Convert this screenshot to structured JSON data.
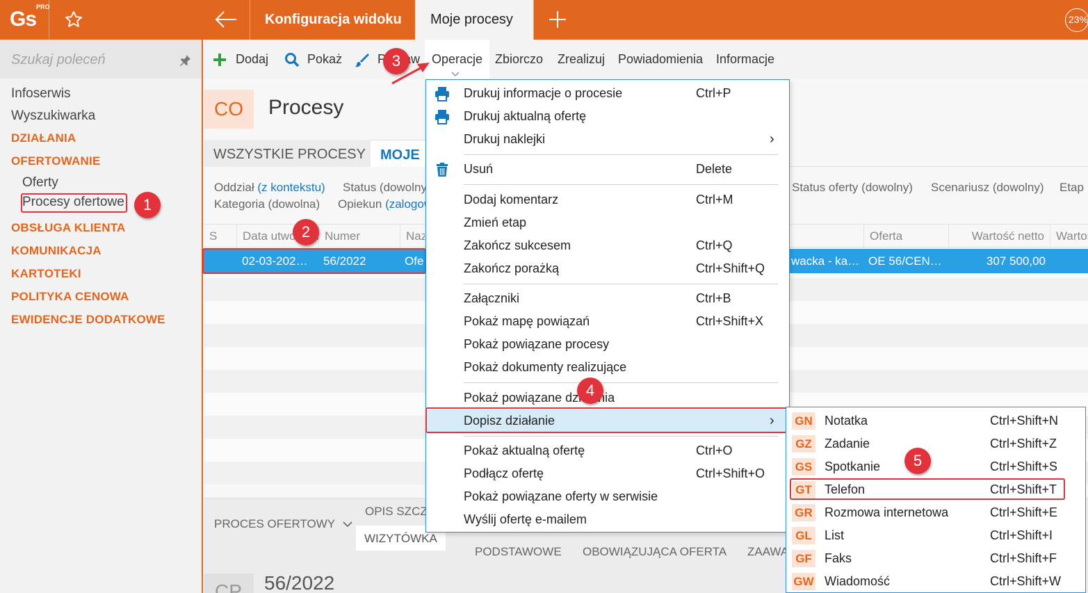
{
  "app": {
    "logo_text": "Gs",
    "logo_badge": "PRO",
    "zoom": "23%"
  },
  "tabs": [
    {
      "label": "Konfiguracja widoku"
    },
    {
      "label": "Moje procesy"
    }
  ],
  "sidebar": {
    "search_placeholder": "Szukaj poleceń",
    "items": [
      {
        "label": "Infoserwis"
      },
      {
        "label": "Wyszukiwarka"
      }
    ],
    "sections": [
      {
        "label": "DZIAŁANIA"
      },
      {
        "label": "OFERTOWANIE"
      },
      {
        "label": "OBSŁUGA KLIENTA"
      },
      {
        "label": "KOMUNIKACJA"
      },
      {
        "label": "KARTOTEKI"
      },
      {
        "label": "POLITYKA CENOWA"
      },
      {
        "label": "EWIDENCJE DODATKOWE"
      }
    ],
    "sub_items": [
      {
        "label": "Oferty"
      },
      {
        "label": "Procesy ofertowe"
      }
    ]
  },
  "toolbar": {
    "add": "Dodaj",
    "show": "Pokaż",
    "edit": "Popraw",
    "operations": "Operacje",
    "summary": "Zbiorczo",
    "realize": "Zrealizuj",
    "notifications": "Powiadomienia",
    "info": "Informacje"
  },
  "page": {
    "badge": "CO",
    "title": "Procesy",
    "tabs": {
      "all": "WSZYSTKIE PROCESY",
      "mine": "MOJE"
    }
  },
  "filters": {
    "branch_label": "Oddział",
    "branch_value": "(z kontekstu)",
    "status": "Status (dowolny)",
    "category": "Kategoria (dowolna)",
    "guardian_label": "Opiekun",
    "guardian_value": "(zalogowany)",
    "offer_status": "Status oferty (dowolny)",
    "scenario": "Scenariusz (dowolny)",
    "stage": "Etap"
  },
  "grid": {
    "headers": {
      "s": "S",
      "date": "Data utworzenia",
      "number": "Numer",
      "name": "Nazwa",
      "offer": "Oferta",
      "net_value": "Wartość netto",
      "value2": "Wartość"
    },
    "row": {
      "date": "02-03-202…",
      "number": "56/2022",
      "name": "Ofe",
      "client": "wacka - ka…",
      "offer": "OE 56/CEN…",
      "net_value": "307 500,00"
    }
  },
  "bottom": {
    "section": "PROCES OFERTOWY",
    "desc_tab": "OPIS SZCZEGÓŁOWY",
    "tabs": [
      "WIZYTÓWKA",
      "PODSTAWOWE",
      "OBOWIĄZUJĄCA OFERTA",
      "ZAAWANSOWANE"
    ],
    "badge": "CP",
    "number": "56/2022"
  },
  "menu": {
    "items": [
      {
        "label": "Drukuj informacje o procesie",
        "shortcut": "Ctrl+P",
        "icon": "printer-icon"
      },
      {
        "label": "Drukuj aktualną ofertę",
        "shortcut": "",
        "icon": "printer-icon"
      },
      {
        "label": "Drukuj naklejki",
        "shortcut": "",
        "submenu": true
      },
      {
        "label": "Usuń",
        "shortcut": "Delete",
        "icon": "trash-icon"
      },
      {
        "label": "Dodaj komentarz",
        "shortcut": "Ctrl+M"
      },
      {
        "label": "Zmień etap",
        "shortcut": ""
      },
      {
        "label": "Zakończ sukcesem",
        "shortcut": "Ctrl+Q"
      },
      {
        "label": "Zakończ porażką",
        "shortcut": "Ctrl+Shift+Q"
      },
      {
        "label": "Załączniki",
        "shortcut": "Ctrl+B"
      },
      {
        "label": "Pokaż mapę powiązań",
        "shortcut": "Ctrl+Shift+X"
      },
      {
        "label": "Pokaż powiązane procesy",
        "shortcut": ""
      },
      {
        "label": "Pokaż dokumenty realizujące",
        "shortcut": ""
      },
      {
        "label": "Pokaż powiązane działania",
        "shortcut": ""
      },
      {
        "label": "Dopisz działanie",
        "shortcut": "",
        "submenu": true
      },
      {
        "label": "Pokaż aktualną ofertę",
        "shortcut": "Ctrl+O"
      },
      {
        "label": "Podłącz ofertę",
        "shortcut": "Ctrl+Shift+O"
      },
      {
        "label": "Pokaż powiązane oferty w serwisie",
        "shortcut": ""
      },
      {
        "label": "Wyślij ofertę e-mailem",
        "shortcut": ""
      }
    ]
  },
  "submenu": {
    "items": [
      {
        "code": "GN",
        "label": "Notatka",
        "shortcut": "Ctrl+Shift+N"
      },
      {
        "code": "GZ",
        "label": "Zadanie",
        "shortcut": "Ctrl+Shift+Z"
      },
      {
        "code": "GS",
        "label": "Spotkanie",
        "shortcut": "Ctrl+Shift+S"
      },
      {
        "code": "GT",
        "label": "Telefon",
        "shortcut": "Ctrl+Shift+T"
      },
      {
        "code": "GR",
        "label": "Rozmowa internetowa",
        "shortcut": "Ctrl+Shift+E"
      },
      {
        "code": "GL",
        "label": "List",
        "shortcut": "Ctrl+Shift+I"
      },
      {
        "code": "GF",
        "label": "Faks",
        "shortcut": "Ctrl+Shift+F"
      },
      {
        "code": "GW",
        "label": "Wiadomość",
        "shortcut": "Ctrl+Shift+W"
      }
    ]
  },
  "steps": [
    "1",
    "2",
    "3",
    "4",
    "5"
  ],
  "colors": {
    "accent": "#e2661d",
    "selection": "#29a0e3",
    "link": "#1777bd",
    "callout": "#e2333c"
  }
}
